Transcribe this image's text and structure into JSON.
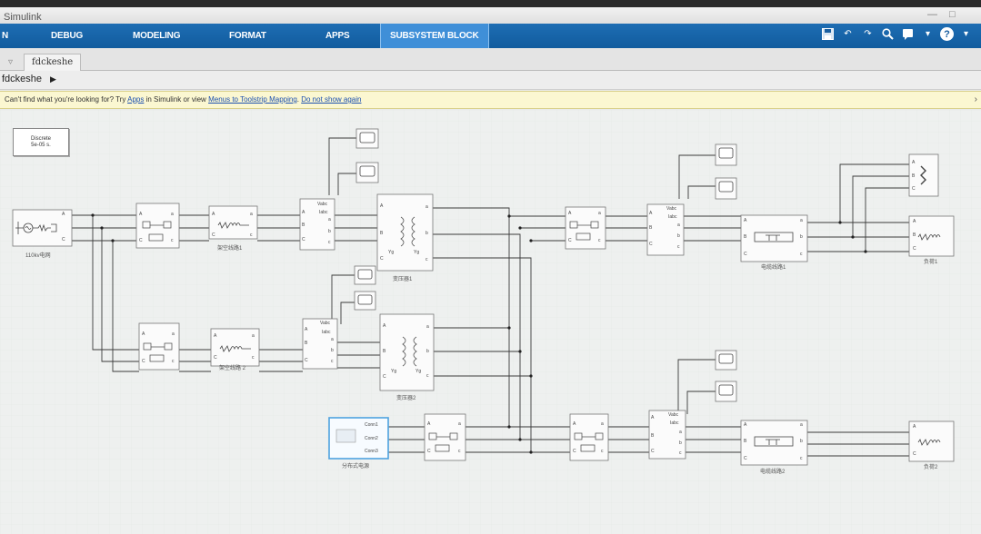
{
  "window": {
    "app_title": "Simulink"
  },
  "ribbon": {
    "tabs": [
      {
        "label": "DEBUG"
      },
      {
        "label": "MODELING"
      },
      {
        "label": "FORMAT"
      },
      {
        "label": "APPS"
      },
      {
        "label": "SUBSYSTEM BLOCK",
        "active": true
      }
    ],
    "quick_access_icons": [
      "save-icon",
      "undo-icon",
      "redo-icon",
      "search-icon",
      "dropdown-icon",
      "help-icon"
    ],
    "accent_color": "#115c9e"
  },
  "model_tab": {
    "label": "fdckeshe"
  },
  "breadcrumb": {
    "label": "fdckeshe"
  },
  "infobar": {
    "prefix": "Can't find what you're looking for? Try",
    "link_apps": "Apps",
    "middle": "in Simulink or view",
    "link_mapping": "Menus to Toolstrip Mapping",
    "link_hide": "Do not show again",
    "background_color": "#fbf7d1"
  },
  "diagram": {
    "powergui": {
      "line1": "Discrete",
      "line2": "5e-05 s."
    },
    "captions": {
      "source": "110kv电网",
      "line1": "架空线路1",
      "line2": "架空线路 2",
      "transformer1": "变压器1",
      "transformer2": "变压器2",
      "cable1": "电缆线路1",
      "cable2": "电缆线路2",
      "distributed_source": "分布式电源",
      "load1": "负荷1",
      "load2": "负荷2"
    },
    "port_labels": {
      "phase_a": "A",
      "phase_b": "B",
      "phase_c": "C",
      "out_a": "a",
      "out_b": "b",
      "out_c": "c",
      "vabc": "Vabc",
      "iabc": "Iabc",
      "yg": "Yg",
      "conn1": "Conn1",
      "conn2": "Conn2",
      "conn3": "Conn3"
    }
  }
}
